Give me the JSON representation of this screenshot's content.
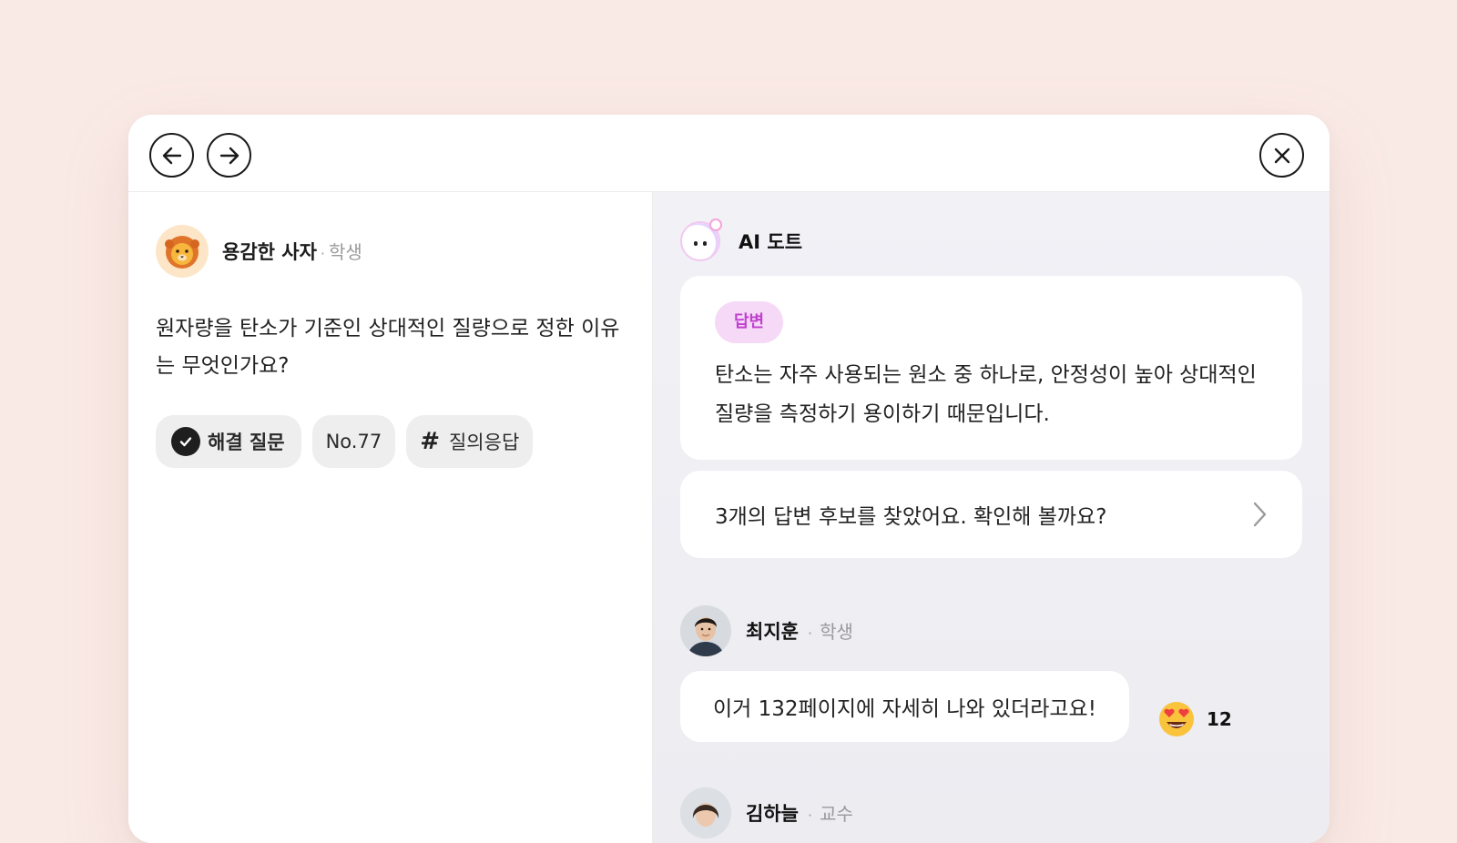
{
  "nav": {
    "back_icon": "arrow-left-icon",
    "forward_icon": "arrow-right-icon",
    "close_icon": "close-icon"
  },
  "question": {
    "author": "용감한 사자",
    "separator": "·",
    "role": "학생",
    "avatar_icon": "lion-icon",
    "text": "원자량을 탄소가 기준인 상대적인 질량으로 정한 이유는 무엇인가요?",
    "tags": [
      {
        "label": "해결 질문",
        "icon": "check-icon"
      },
      {
        "label": "No.77"
      },
      {
        "label": "질의응답",
        "icon": "hash-icon"
      }
    ]
  },
  "ai": {
    "name": "AI 도트",
    "answer_badge": "답변",
    "answer_text": "탄소는 자주 사용되는 원소 중 하나로, 안정성이 높아 상대적인 질량을 측정하기 용이하기 때문입니다.",
    "candidates_text": "3개의 답변 후보를 찾았어요. 확인해 볼까요?"
  },
  "replies": [
    {
      "name": "최지훈",
      "separator": "·",
      "role": "학생",
      "text": "이거 132페이지에 자세히 나와 있더라고요!",
      "reaction_icon": "heart-eyes-emoji-icon",
      "reaction_count": "12"
    },
    {
      "name": "김하늘",
      "separator": "·",
      "role": "교수"
    }
  ],
  "colors": {
    "page_bg": "#faeae6",
    "badge_bg": "#f5d9f6",
    "badge_text": "#c13fcf"
  }
}
